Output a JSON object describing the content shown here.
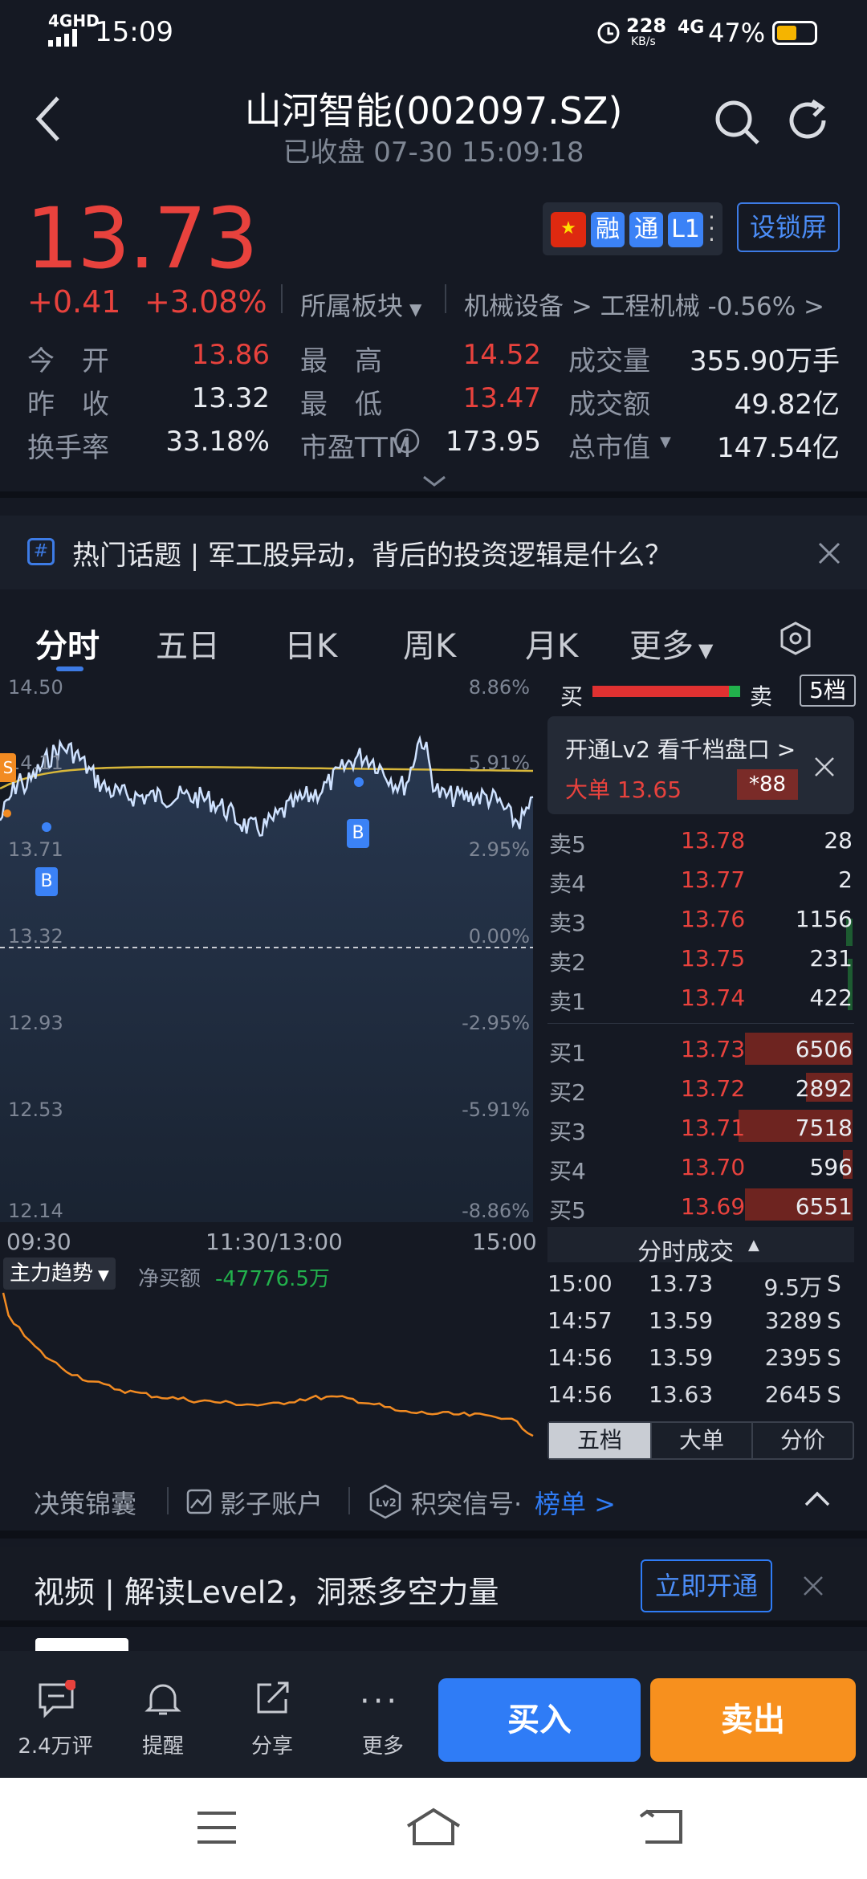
{
  "status": {
    "network": "4GHD",
    "time": "15:09",
    "speed_value": "228",
    "speed_unit": "KB/s",
    "signal2": "4G",
    "battery": "47%"
  },
  "header": {
    "title": "山河智能(002097.SZ)",
    "subtitle": "已收盘 07-30 15:09:18"
  },
  "quote": {
    "price": "13.73",
    "change": "+0.41",
    "change_pct": "+3.08%",
    "sector_label": "所属板块",
    "sector_path": "机械设备 > 工程机械 -0.56% >",
    "tags": [
      "融",
      "通",
      "L1"
    ],
    "lock_screen": "设锁屏",
    "stats": [
      {
        "label": "今　开",
        "value": "13.86",
        "color": "red"
      },
      {
        "label": "最　高",
        "value": "14.52",
        "color": "red"
      },
      {
        "label": "成交量",
        "value": "355.90万手",
        "color": "white"
      },
      {
        "label": "昨　收",
        "value": "13.32",
        "color": "white"
      },
      {
        "label": "最　低",
        "value": "13.47",
        "color": "red"
      },
      {
        "label": "成交额",
        "value": "49.82亿",
        "color": "white"
      },
      {
        "label": "换手率",
        "value": "33.18%",
        "color": "white"
      },
      {
        "label": "市盈TTM",
        "value": "173.95",
        "color": "white"
      },
      {
        "label": "总市值",
        "value": "147.54亿",
        "color": "white"
      }
    ]
  },
  "topic": {
    "text": "热门话题 | 军工股异动，背后的投资逻辑是什么？"
  },
  "tabs": [
    "分时",
    "五日",
    "日K",
    "周K",
    "月K",
    "更多"
  ],
  "chart": {
    "left_axis": [
      "14.50",
      "14.11",
      "13.71",
      "13.32",
      "12.93",
      "12.53",
      "12.14"
    ],
    "right_axis": [
      "8.86%",
      "5.91%",
      "2.95%",
      "0.00%",
      "-2.95%",
      "-5.91%",
      "-8.86%"
    ],
    "time_labels": [
      "09:30",
      "11:30/13:00",
      "15:00"
    ],
    "markers": [
      "S",
      "B",
      "B"
    ],
    "main_force_label": "主力趋势",
    "net_buy_label": "净买额",
    "net_buy_value": "-47776.5万"
  },
  "orderbook": {
    "buy_label": "买",
    "sell_label": "卖",
    "depth_button": "5档",
    "lv2_promo": "开通Lv2 看千档盘口 >",
    "big_order_label": "大单 13.65",
    "big_order_value": "*88",
    "asks": [
      {
        "label": "卖5",
        "price": "13.78",
        "vol": "28"
      },
      {
        "label": "卖4",
        "price": "13.77",
        "vol": "2"
      },
      {
        "label": "卖3",
        "price": "13.76",
        "vol": "1156"
      },
      {
        "label": "卖2",
        "price": "13.75",
        "vol": "231"
      },
      {
        "label": "卖1",
        "price": "13.74",
        "vol": "422"
      }
    ],
    "bids": [
      {
        "label": "买1",
        "price": "13.73",
        "vol": "6506"
      },
      {
        "label": "买2",
        "price": "13.72",
        "vol": "2892"
      },
      {
        "label": "买3",
        "price": "13.71",
        "vol": "7518"
      },
      {
        "label": "买4",
        "price": "13.70",
        "vol": "596"
      },
      {
        "label": "买5",
        "price": "13.69",
        "vol": "6551"
      }
    ],
    "trades_title": "分时成交",
    "trades": [
      {
        "time": "15:00",
        "price": "13.73",
        "vol": "9.5万",
        "side": "S"
      },
      {
        "time": "14:57",
        "price": "13.59",
        "vol": "3289",
        "side": "S"
      },
      {
        "time": "14:56",
        "price": "13.59",
        "vol": "2395",
        "side": "S"
      },
      {
        "time": "14:56",
        "price": "13.63",
        "vol": "2645",
        "side": "S"
      }
    ],
    "seg_tabs": [
      "五档",
      "大单",
      "分价"
    ]
  },
  "tools": {
    "decision": "决策锦囊",
    "shadow": "影子账户",
    "signal": "积突信号·",
    "rank": "榜单 >"
  },
  "promo": {
    "text": "视频 | 解读Level2，洞悉多空力量",
    "button": "立即开通"
  },
  "bottom": {
    "comments": "2.4万评",
    "remind": "提醒",
    "share": "分享",
    "more": "更多",
    "buy": "买入",
    "sell": "卖出"
  }
}
